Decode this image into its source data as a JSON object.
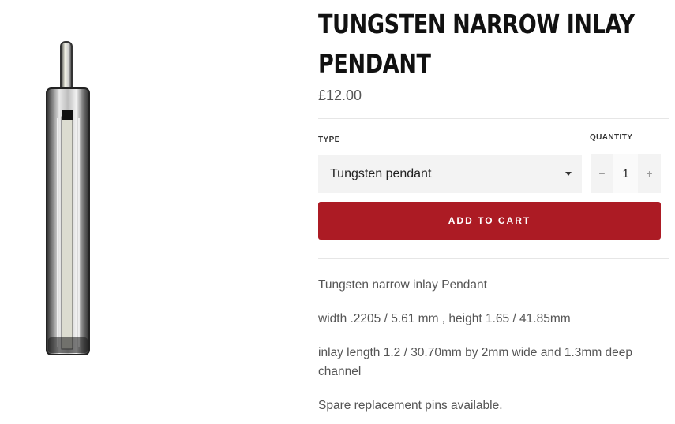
{
  "product": {
    "title": "TUNGSTEN NARROW INLAY PENDANT",
    "price": "£12.00",
    "image_alt": "tungsten-pendant-image"
  },
  "options": {
    "type_label": "TYPE",
    "type_value": "Tungsten pendant",
    "quantity_label": "QUANTITY",
    "quantity_value": "1",
    "minus_symbol": "−",
    "plus_symbol": "+"
  },
  "actions": {
    "add_to_cart_label": "ADD TO CART"
  },
  "description": {
    "lines": [
      "Tungsten narrow inlay Pendant",
      "width .2205 / 5.61 mm , height 1.65 / 41.85mm",
      "inlay length 1.2 / 30.70mm by 2mm wide and 1.3mm deep channel",
      "Spare replacement pins available."
    ]
  },
  "colors": {
    "accent": "#ac1b24",
    "field_bg": "#f3f3f3"
  }
}
